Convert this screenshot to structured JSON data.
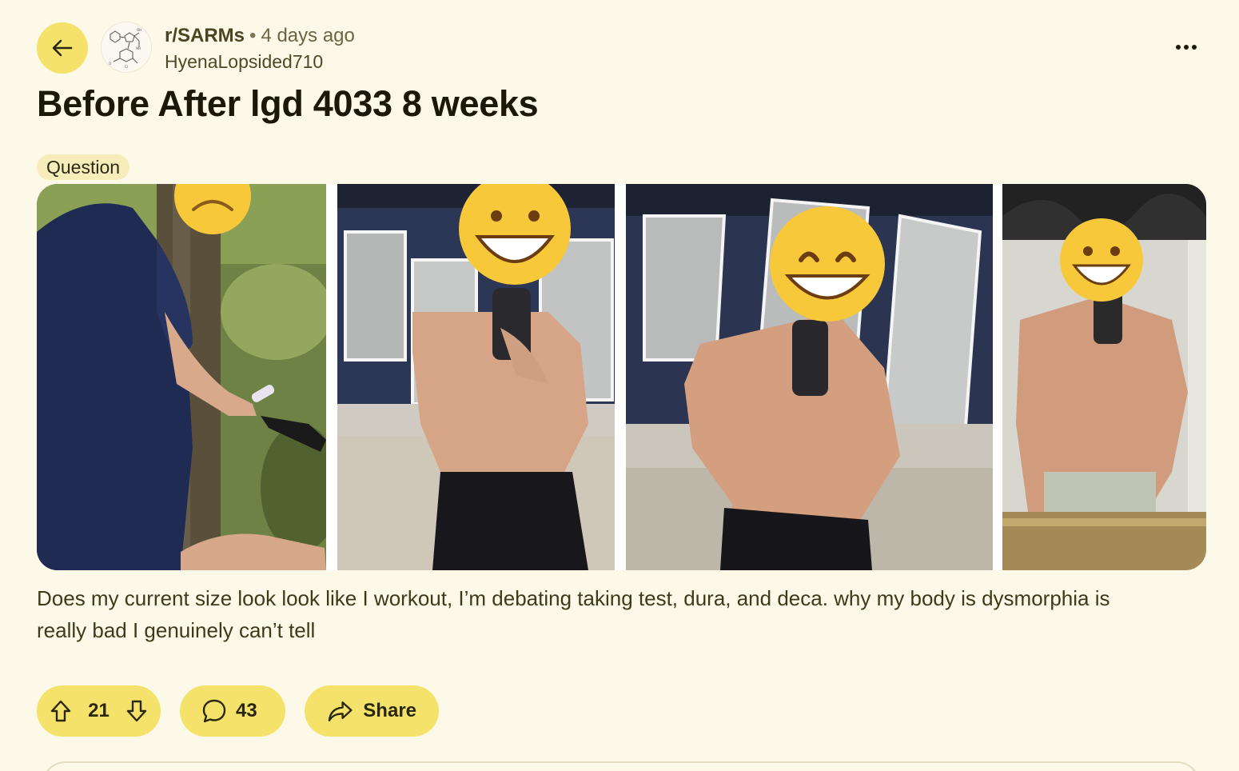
{
  "post": {
    "subreddit": "r/SARMs",
    "separator": "•",
    "time": "4 days ago",
    "author": "HyenaLopsided710",
    "title": "Before After lgd 4033 8 weeks",
    "flair": "Question",
    "body": "Does my current size look look like I workout, I’m debating taking test, dura, and deca. why my body is dysmorphia is really bad I genuinely can’t tell"
  },
  "actions": {
    "upvotes": "21",
    "comments": "43",
    "share_label": "Share"
  },
  "icons": {
    "back": "arrow-left-icon",
    "more": "ellipsis-icon",
    "upvote": "arrow-up-icon",
    "downvote": "arrow-down-icon",
    "comment": "speech-bubble-icon",
    "share": "share-arrow-icon"
  },
  "colors": {
    "background": "#fdf9e8",
    "accent": "#f5e26a",
    "flair_bg": "#f6edbb",
    "text": "#1c1a0f"
  }
}
